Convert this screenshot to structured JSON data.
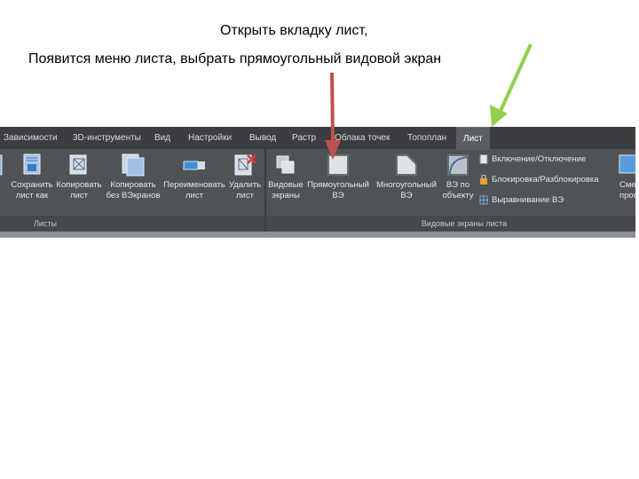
{
  "captions": {
    "line1": "Открыть вкладку лист,",
    "line2": "Появится меню листа, выбрать прямоугольный видовой экран"
  },
  "ribbon": {
    "tabs": [
      "Зависимости",
      "3D-инструменты",
      "Вид",
      "Настройки",
      "Вывод",
      "Растр",
      "Облака точек",
      "Топоплан",
      "Лист"
    ],
    "active_tab": "Лист",
    "panels": {
      "sheets": {
        "title": "Листы",
        "tools": [
          {
            "label": "Сохранить\nлист как",
            "icon": "save-sheet-icon"
          },
          {
            "label": "Копировать\nлист",
            "icon": "copy-sheet-icon"
          },
          {
            "label": "Копировать\nбез ВЭкранов",
            "icon": "copy-no-viewports-icon"
          },
          {
            "label": "Переименовать\nлист",
            "icon": "rename-sheet-icon"
          },
          {
            "label": "Удалить\nлист",
            "icon": "delete-sheet-icon"
          }
        ]
      },
      "viewports": {
        "title": "Видовые экраны листа",
        "tools": [
          {
            "label": "Видовые\nэкраны",
            "icon": "viewports-icon"
          },
          {
            "label": "Прямоугольный\nВЭ",
            "icon": "rectangular-viewport-icon"
          },
          {
            "label": "Многоугольный\nВЭ",
            "icon": "polygonal-viewport-icon"
          },
          {
            "label": "ВЭ по\nобъекту",
            "icon": "object-viewport-icon"
          }
        ],
        "side_items": [
          {
            "label": "Включение/Отключение",
            "icon": "toggle-viewport-icon"
          },
          {
            "label": "Блокировка/Разблокировка",
            "icon": "lock-icon"
          },
          {
            "label": "Выравнивание ВЭ",
            "icon": "align-viewport-icon"
          }
        ],
        "partial_tool": {
          "label": "Сме\nпростра",
          "icon": "switch-space-icon"
        }
      }
    }
  },
  "arrows": {
    "red": "#c0504d",
    "green": "#92d050"
  }
}
